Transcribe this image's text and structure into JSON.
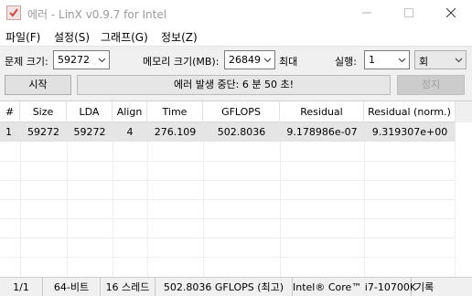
{
  "window": {
    "title": "에러 - LinX v0.9.7 for Intel",
    "icon": "checkbox-check-icon"
  },
  "menu": [
    {
      "label": "파일(F)"
    },
    {
      "label": "설정(S)"
    },
    {
      "label": "그래프(G)"
    },
    {
      "label": "정보(Z)"
    }
  ],
  "params": {
    "problem_size_label": "문제 크기:",
    "problem_size_value": "59272",
    "memory_label": "메모리 크기(MB):",
    "memory_value": "26849",
    "memory_suffix": "최대",
    "runs_label": "실행:",
    "runs_value": "1",
    "runs_unit": "회"
  },
  "actions": {
    "start_label": "시작",
    "status_text": "에러 발생 중단: 6 분 50 초!",
    "stop_label": "정지"
  },
  "table": {
    "columns": [
      "#",
      "Size",
      "LDA",
      "Align",
      "Time",
      "GFLOPS",
      "Residual",
      "Residual (norm.)"
    ],
    "rows": [
      [
        "1",
        "59272",
        "59272",
        "4",
        "276.109",
        "502.8036",
        "9.178986e-07",
        "9.319307e+00"
      ]
    ]
  },
  "statusbar": {
    "progress": "1/1",
    "bits": "64-비트",
    "threads": "16 스레드",
    "peak": "502.8036 GFLOPS (최고)",
    "cpu": "Intel® Core™ i7-10700K",
    "log_label": "기록"
  },
  "colors": {
    "row_highlight": "#e5e5e5",
    "toolbar_bg": "#f0f0f0",
    "disabled_text": "#a0a0a0"
  }
}
